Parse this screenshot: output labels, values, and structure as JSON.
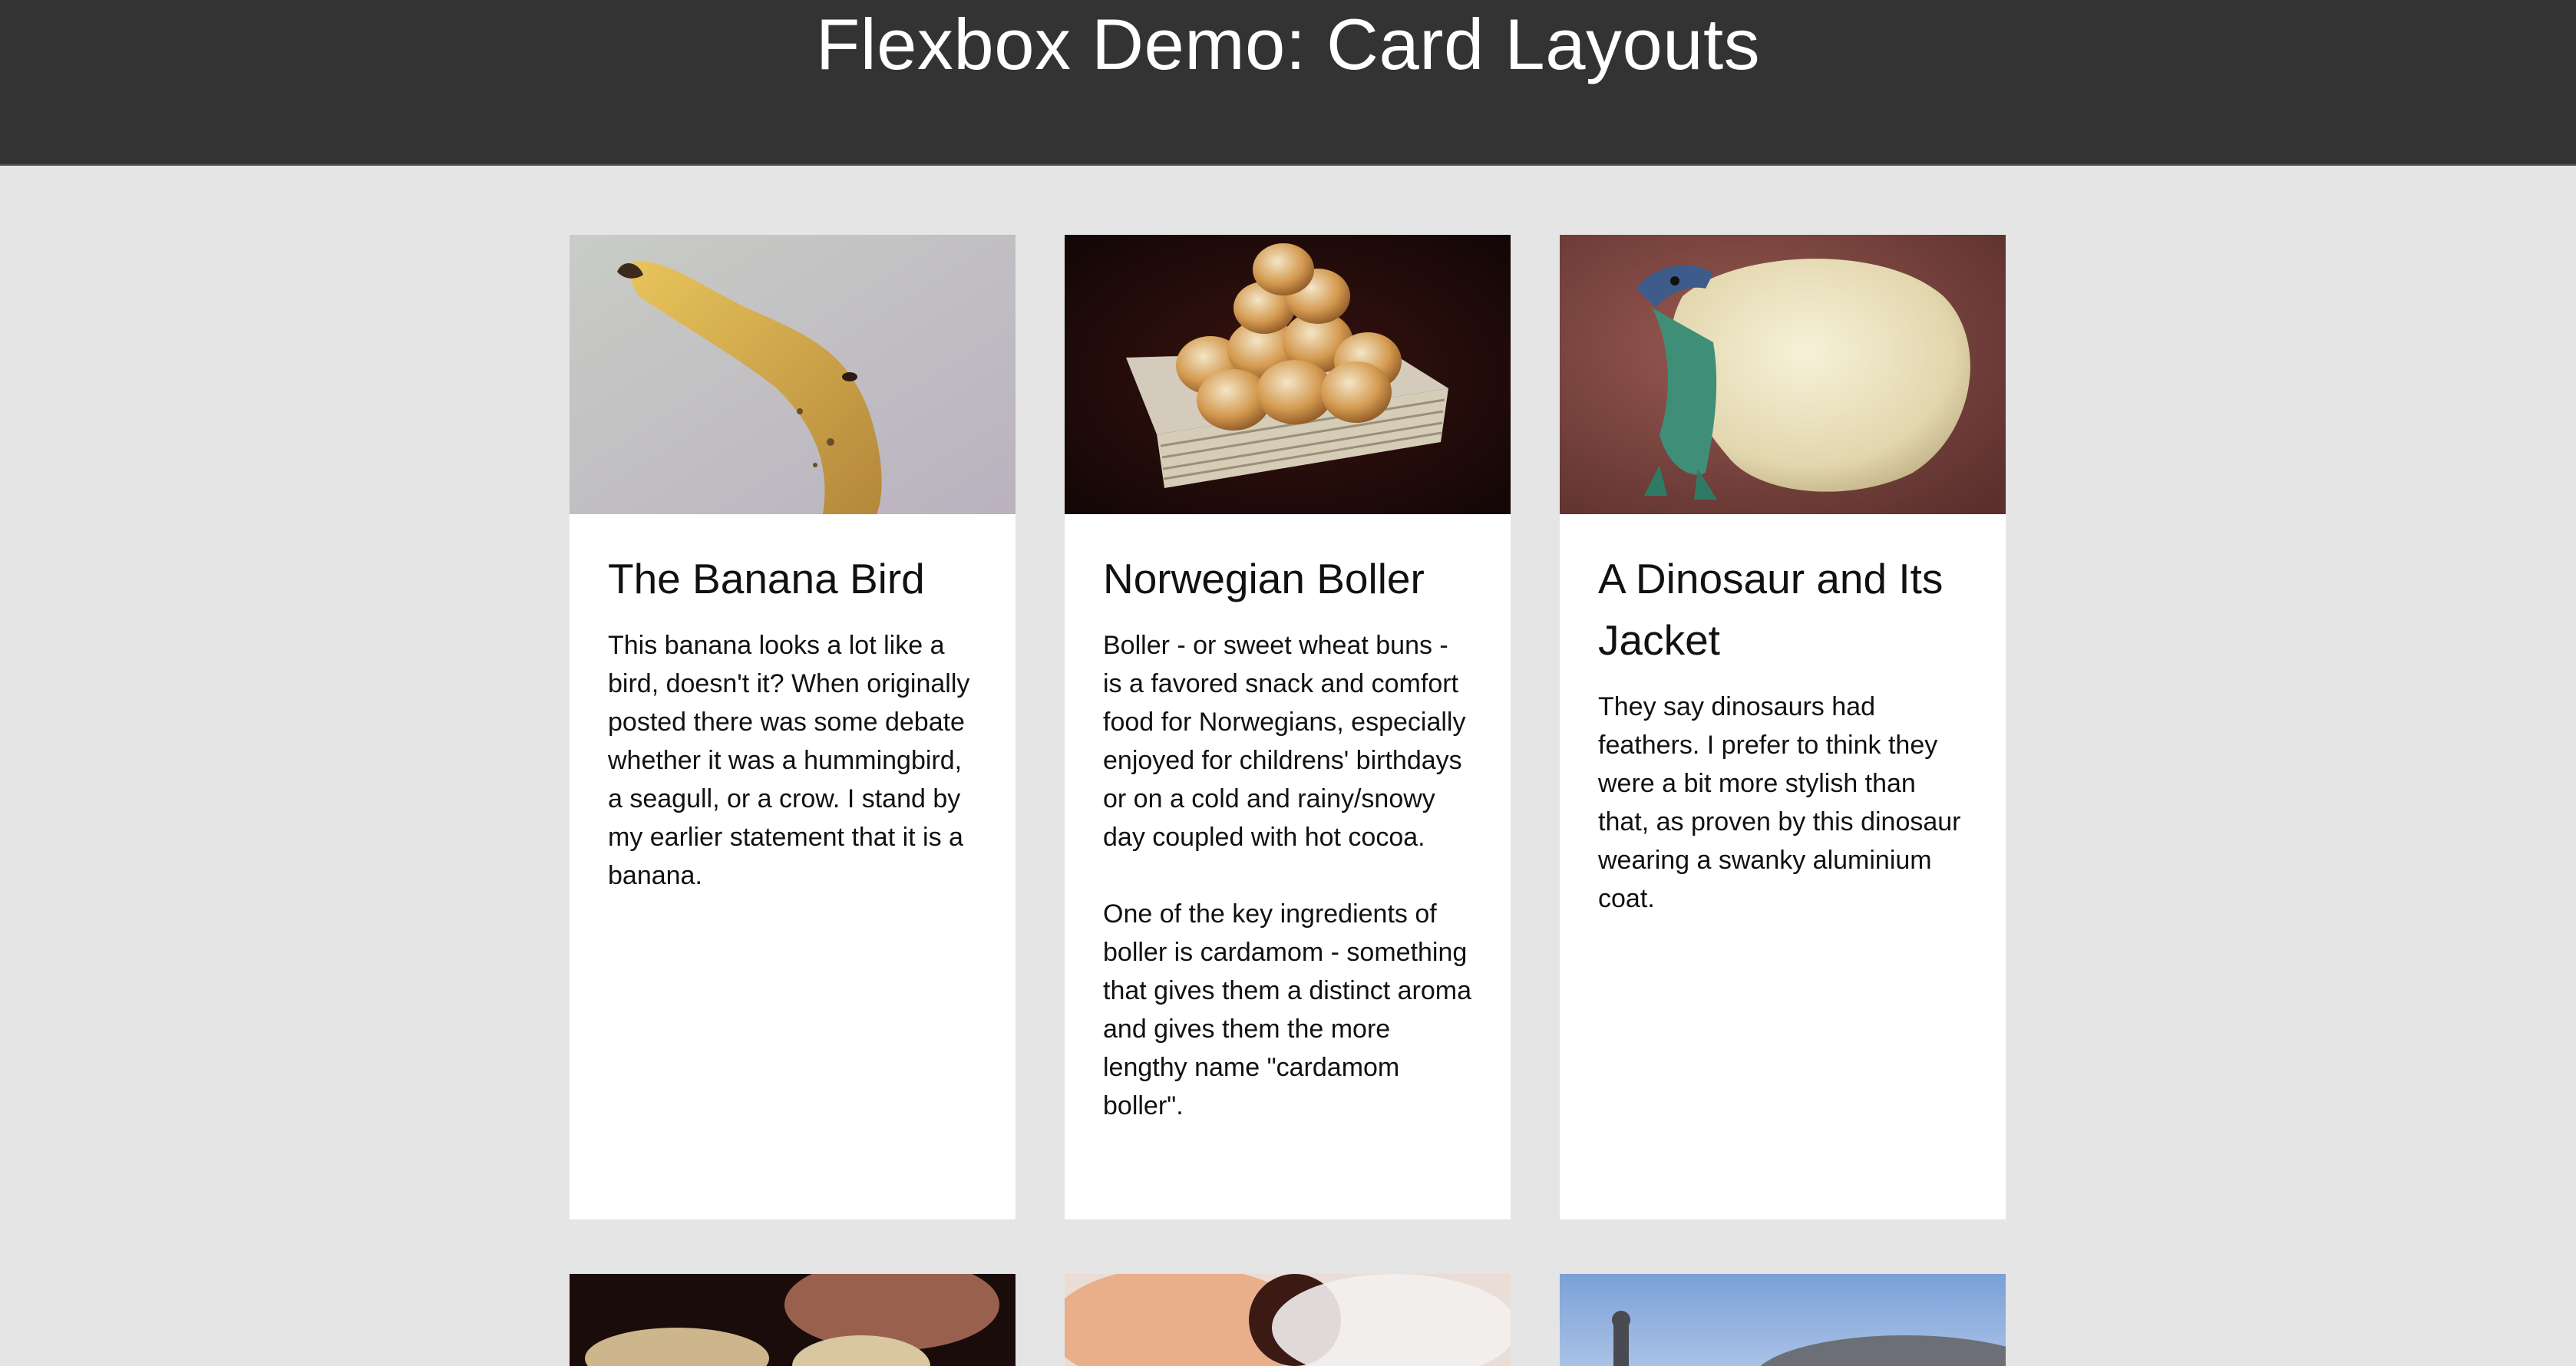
{
  "header": {
    "title": "Flexbox Demo: Card Layouts"
  },
  "cards": [
    {
      "title": "The Banana Bird",
      "paragraphs": [
        "This banana looks a lot like a bird, doesn't it? When originally posted there was some debate whether it was a hummingbird, a seagull, or a crow. I stand by my earlier statement that it is a banana."
      ]
    },
    {
      "title": "Norwegian Boller",
      "paragraphs": [
        "Boller - or sweet wheat buns - is a favored snack and comfort food for Norwegians, especially enjoyed for childrens' birthdays or on a cold and rainy/snowy day coupled with hot cocoa.",
        "One of the key ingredients of boller is cardamom - something that gives them a distinct aroma and gives them the more lengthy name \"cardamom boller\"."
      ]
    },
    {
      "title": "A Dinosaur and Its Jacket",
      "paragraphs": [
        "They say dinosaurs had feathers. I prefer to think they were a bit more stylish than that, as proven by this dinosaur wearing a swanky aluminium coat."
      ]
    }
  ],
  "colors": {
    "header_bg": "#333333",
    "page_bg": "#e5e5e5",
    "card_bg": "#ffffff"
  }
}
